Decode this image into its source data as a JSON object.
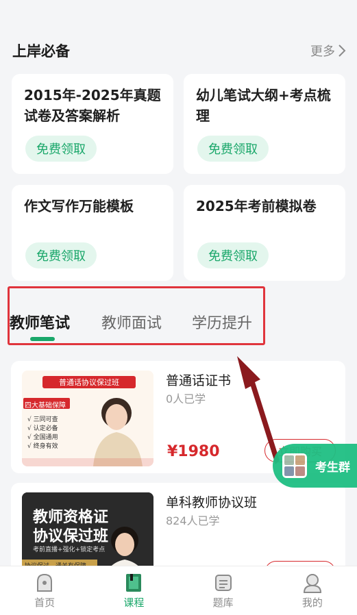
{
  "section": {
    "title": "上岸必备",
    "more": "更多"
  },
  "cards": [
    {
      "title": "2015年-2025年真题试卷及答案解析",
      "button": "免费领取"
    },
    {
      "title": "幼儿笔试大纲+考点梳理",
      "button": "免费领取"
    },
    {
      "title": "作文写作万能模板",
      "button": "免费领取"
    },
    {
      "title": "2025年考前模拟卷",
      "button": "免费领取"
    }
  ],
  "tabs": [
    {
      "label": "教师笔试",
      "active": true
    },
    {
      "label": "教师面试",
      "active": false
    },
    {
      "label": "学历提升",
      "active": false
    }
  ],
  "courses": [
    {
      "name": "普通话证书",
      "learners": "0人已学",
      "price": "¥1980",
      "buy": "立即购买",
      "thumb": {
        "banner": "普通话协议保过班",
        "tag": "四大基础保障",
        "points": [
          "三同可查",
          "认定必备",
          "全国通用",
          "终身有效"
        ]
      }
    },
    {
      "name": "单科教师协议班",
      "learners": "824人已学",
      "price": "",
      "buy": "",
      "thumb": {
        "line1": "教师资格证",
        "line2": "协议保过班",
        "sub": "考前直播+强化+锁定考点",
        "strip": "协议保过，通关有保障"
      }
    }
  ],
  "group": {
    "label": "考生群"
  },
  "tabbar": [
    {
      "label": "首页",
      "icon": "home-icon",
      "active": false
    },
    {
      "label": "课程",
      "icon": "course-icon",
      "active": true
    },
    {
      "label": "题库",
      "icon": "question-bank-icon",
      "active": false
    },
    {
      "label": "我的",
      "icon": "profile-icon",
      "active": false
    }
  ],
  "colors": {
    "accent": "#1aa76a",
    "price": "#d6282c",
    "highlight": "#e0343c"
  }
}
